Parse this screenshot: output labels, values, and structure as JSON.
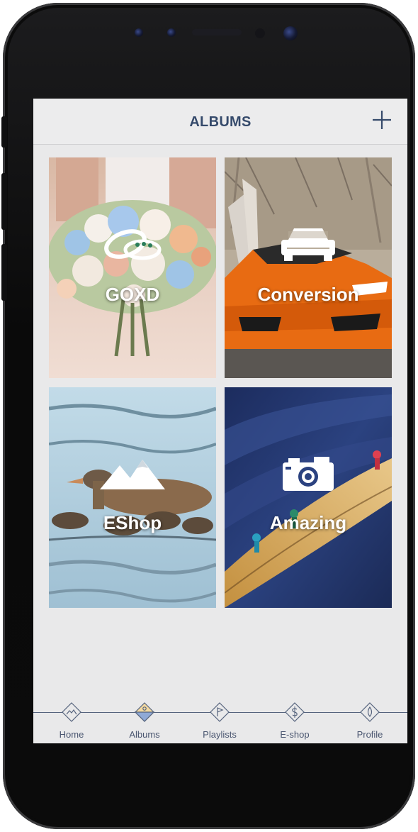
{
  "header": {
    "title": "ALBUMS",
    "add_icon": "plus-icon"
  },
  "albums": [
    {
      "label": "GOXD",
      "icon": "rings-icon"
    },
    {
      "label": "Conversion",
      "icon": "car-icon"
    },
    {
      "label": "EShop",
      "icon": "mountains-icon"
    },
    {
      "label": "Amazing",
      "icon": "camera-icon"
    }
  ],
  "tabbar": {
    "items": [
      {
        "label": "Home",
        "icon": "mountain-diamond-icon",
        "active": false
      },
      {
        "label": "Albums",
        "icon": "album-diamond-icon",
        "active": true
      },
      {
        "label": "Playlists",
        "icon": "play-diamond-icon",
        "active": false
      },
      {
        "label": "E-shop",
        "icon": "dollar-diamond-icon",
        "active": false
      },
      {
        "label": "Profile",
        "icon": "drop-diamond-icon",
        "active": false
      }
    ]
  },
  "colors": {
    "accent": "#354a6b",
    "active_tab": "#8fa9d6",
    "screen_bg": "#e9e9ea"
  }
}
